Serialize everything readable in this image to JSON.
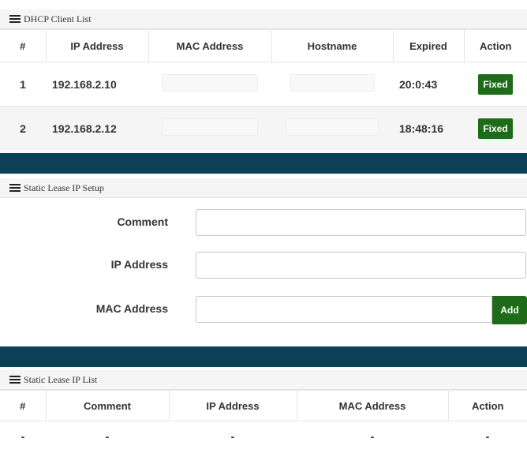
{
  "client_list": {
    "title": "DHCP Client List",
    "columns": [
      "#",
      "IP Address",
      "MAC Address",
      "Hostname",
      "Expired",
      "Action"
    ],
    "rows": [
      {
        "num": "1",
        "ip": "192.168.2.10",
        "mac": "",
        "hostname": "",
        "expired": "20:0:43",
        "action": "Fixed"
      },
      {
        "num": "2",
        "ip": "192.168.2.12",
        "mac": "",
        "hostname": "",
        "expired": "18:48:16",
        "action": "Fixed"
      }
    ]
  },
  "static_setup": {
    "title": "Static Lease IP Setup",
    "comment_label": "Comment",
    "ip_label": "IP Address",
    "mac_label": "MAC Address",
    "comment_value": "",
    "ip_value": "",
    "mac_value": "",
    "add_label": "Add"
  },
  "static_list": {
    "title": "Static Lease IP List",
    "columns": [
      "#",
      "Comment",
      "IP Address",
      "MAC Address",
      "Action"
    ],
    "rows": [
      [
        "-",
        "-",
        "-",
        "-",
        "-"
      ]
    ]
  },
  "colors": {
    "divider": "#0c4157",
    "button_green": "#1e6b1a"
  }
}
